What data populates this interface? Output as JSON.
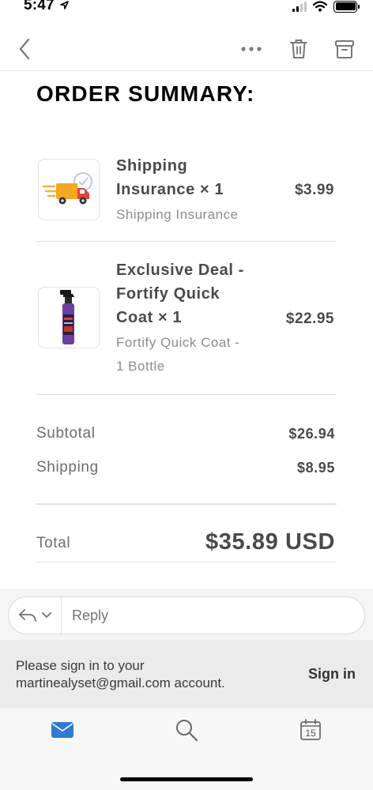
{
  "status_bar": {
    "time": "5:47",
    "location_icon": "location-arrow-icon",
    "signal_icon": "cellular-signal-icon",
    "wifi_icon": "wifi-icon",
    "battery_icon": "battery-icon"
  },
  "toolbar": {
    "back_icon": "chevron-left-icon",
    "more_icon": "more-dots-icon",
    "delete_icon": "trash-icon",
    "archive_icon": "archive-icon"
  },
  "order": {
    "title": "ORDER SUMMARY:",
    "items": [
      {
        "name_line1": "Shipping",
        "name_line2": "Insurance × 1",
        "desc_line1": "Shipping Insurance",
        "price": "$3.99",
        "thumb_icon": "delivery-truck-icon"
      },
      {
        "name_line1": "Exclusive Deal -",
        "name_line2": "Fortify Quick",
        "name_line3": "Coat × 1",
        "desc_line1": "Fortify Quick Coat -",
        "desc_line2": "1 Bottle",
        "price": "$22.95",
        "thumb_icon": "spray-bottle-icon"
      }
    ],
    "subtotal_label": "Subtotal",
    "subtotal_value": "$26.94",
    "shipping_label": "Shipping",
    "shipping_value": "$8.95",
    "total_label": "Total",
    "total_value": "$35.89 USD"
  },
  "reply": {
    "placeholder": "Reply",
    "reply_icon": "reply-arrow-icon",
    "dropdown_icon": "chevron-down-icon"
  },
  "signin": {
    "message_line1": "Please sign in to your",
    "message_line2": "martinealyset@gmail.com account.",
    "button_label": "Sign in"
  },
  "tabbar": {
    "mail_icon": "mail-icon",
    "search_icon": "search-icon",
    "calendar_icon": "calendar-icon",
    "calendar_day": "15",
    "accent_color": "#2f7ad5"
  }
}
